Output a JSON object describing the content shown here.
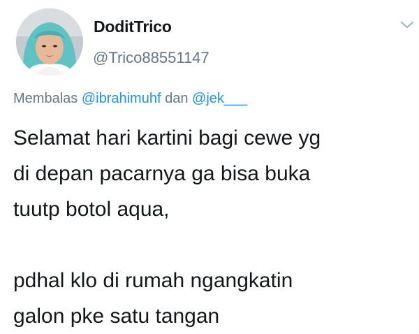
{
  "author": {
    "display_name": "DoditTrico",
    "handle": "@Trico88551147"
  },
  "reply_context": {
    "prefix": "Membalas",
    "mention_1": "@ibrahimuhf",
    "joiner": "dan",
    "mention_2": "@jek___"
  },
  "tweet": {
    "lines": [
      "Selamat hari kartini bagi cewe yg",
      "di depan pacarnya ga bisa buka",
      "tuutp botol aqua,",
      "",
      "pdhal klo di rumah ngangkatin",
      "galon pke satu tangan"
    ]
  },
  "icons": {
    "caret": "chevron-down-icon"
  },
  "colors": {
    "text": "#14171a",
    "secondary": "#657786",
    "mention": "#1b95e0",
    "caret": "#aab8c2"
  }
}
